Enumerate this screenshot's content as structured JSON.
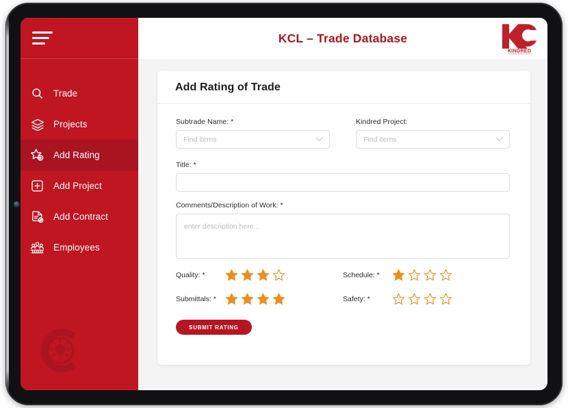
{
  "app": {
    "title": "KCL – Trade Database",
    "brand": {
      "mark": "KC",
      "name": "KINDRED",
      "tagline": "CONSTRUCTION"
    },
    "accent_red": "#bf1622",
    "title_red": "#a81a23",
    "star_orange": "#f08c1b"
  },
  "sidebar": {
    "menu_icon": "hamburger-icon",
    "items": [
      {
        "label": "Trade",
        "icon": "search-icon",
        "active": false
      },
      {
        "label": "Projects",
        "icon": "layers-icon",
        "active": false
      },
      {
        "label": "Add Rating",
        "icon": "star-plus-icon",
        "active": true
      },
      {
        "label": "Add Project",
        "icon": "plus-box-icon",
        "active": false
      },
      {
        "label": "Add Contract",
        "icon": "document-add-icon",
        "active": false
      },
      {
        "label": "Employees",
        "icon": "people-group-icon",
        "active": false
      }
    ],
    "watermark_icon": "c-lightbulb-watermark"
  },
  "form": {
    "card_title": "Add Rating of Trade",
    "subtrade": {
      "label": "Subtrade Name: *",
      "placeholder": "Find items",
      "value": ""
    },
    "project": {
      "label": "Kindred Project:",
      "placeholder": "Find items",
      "value": ""
    },
    "title_field": {
      "label": "Title: *",
      "placeholder": "",
      "value": ""
    },
    "comments": {
      "label": "Comments/Description of Work: *",
      "placeholder": "enter description here...",
      "value": ""
    },
    "ratings": [
      {
        "label": "Quality: *",
        "filled": 3,
        "total": 4
      },
      {
        "label": "Schedule: *",
        "filled": 1,
        "total": 4
      },
      {
        "label": "Submittals: *",
        "filled": 4,
        "total": 4
      },
      {
        "label": "Safety: *",
        "filled": 0,
        "total": 4
      }
    ],
    "submit_label": "SUBMIT RATING"
  }
}
